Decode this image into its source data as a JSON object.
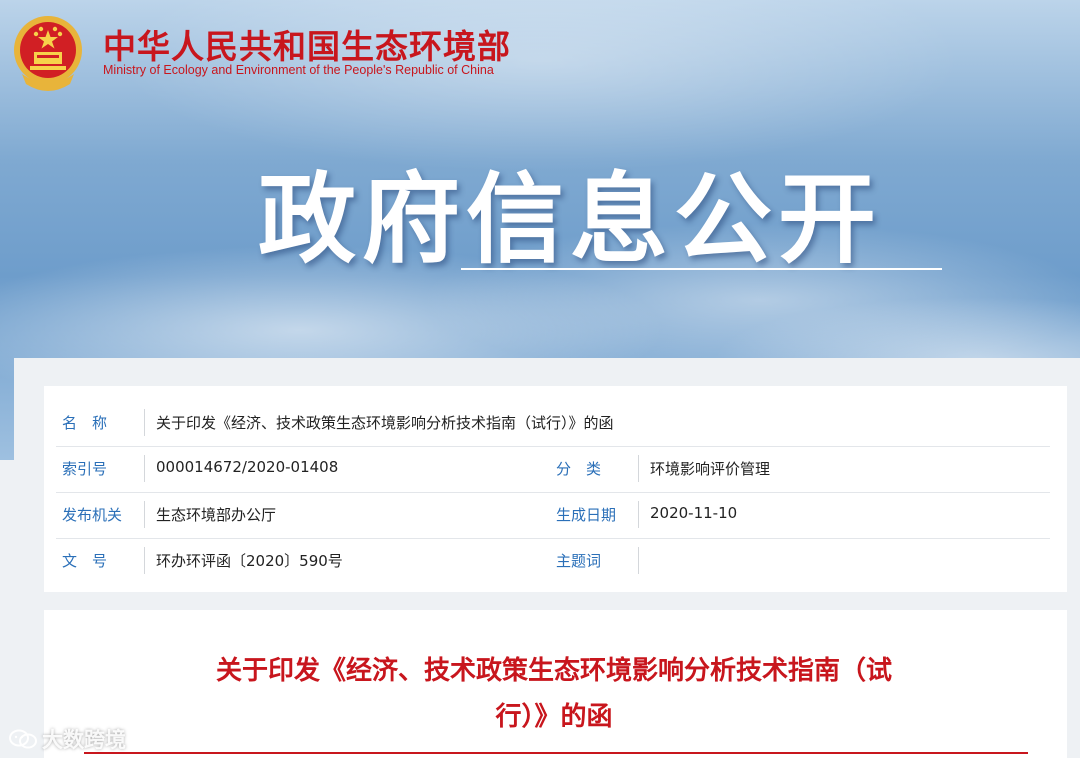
{
  "header": {
    "cn_name": "中华人民共和国生态环境部",
    "en_name": "Ministry of Ecology and Environment of the People's Republic of China",
    "section_title": "政府信息公开"
  },
  "meta": {
    "rows": [
      {
        "label": "名　称",
        "value": "关于印发《经济、技术政策生态环境影响分析技术指南（试行）》的函"
      },
      {
        "label": "索引号",
        "value": "000014672/2020-01408",
        "label2": "分　类",
        "value2": "环境影响评价管理"
      },
      {
        "label": "发布机关",
        "value": "生态环境部办公厅",
        "label2": "生成日期",
        "value2": "2020-11-10"
      },
      {
        "label": "文　号",
        "value": "环办环评函〔2020〕590号",
        "label2": "主题词",
        "value2": ""
      }
    ]
  },
  "document": {
    "title_line1": "关于印发《经济、技术政策生态环境影响分析技术指南（试",
    "title_line2": "行）》的函"
  },
  "watermark": {
    "text": "大数跨境"
  },
  "colors": {
    "brand_red": "#c8161d",
    "label_blue": "#2a6fb8",
    "banner_blue": "#6e9dcb"
  },
  "icons": {
    "emblem": "national-emblem-icon",
    "watermark": "wechat-logo-icon"
  }
}
